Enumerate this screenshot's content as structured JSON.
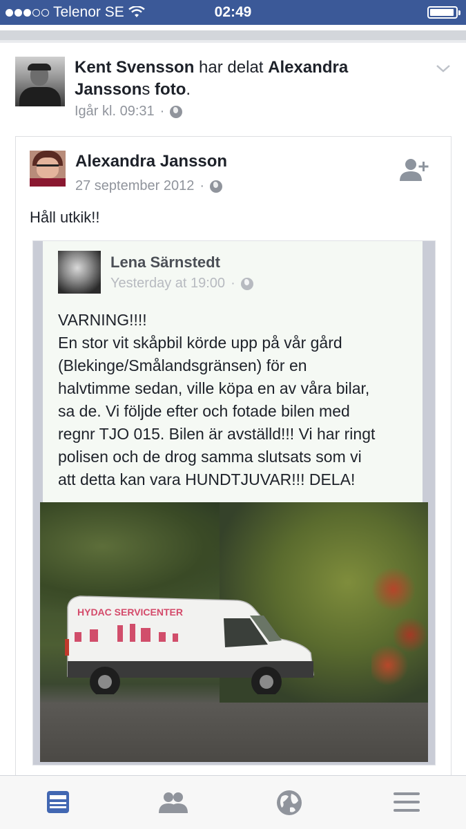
{
  "status_bar": {
    "carrier": "Telenor SE",
    "time": "02:49"
  },
  "shared_post": {
    "sharer_name": "Kent Svensson",
    "action_text": " har delat ",
    "original_owner": "Alexandra Jansson",
    "suffix_s": "s",
    "object": "foto",
    "period": ".",
    "timestamp": "Igår kl. 09:31",
    "separator": "·"
  },
  "original_post": {
    "author": "Alexandra Jansson",
    "date": "27 september 2012",
    "separator": "·",
    "text": "Håll utkik!!"
  },
  "embedded_screenshot": {
    "author": "Lena Särnstedt",
    "time": "Yesterday at 19:00",
    "separator": "·",
    "text": "VARNING!!!!\nEn stor vit skåpbil körde upp på vår gård\n(Blekinge/Smålandsgränsen) för en\nhalvtimme sedan, ville köpa en av våra bilar,\nsa de. Vi följde efter och fotade bilen med\nregnr TJO 015. Bilen är avställd!!! Vi har ringt\npolisen och de drog samma slutsats som vi\natt detta kan vara HUNDTJUVAR!!! DELA!"
  },
  "van_text": "HYDAC SERVICENTER",
  "tab_bar": {
    "tabs": [
      "news-feed",
      "friends",
      "notifications",
      "more"
    ],
    "active_color": "#4267b2",
    "inactive_color": "#90949c"
  },
  "colors": {
    "status_bar": "#3b5998",
    "text": "#1d2129",
    "meta": "#90949c"
  }
}
